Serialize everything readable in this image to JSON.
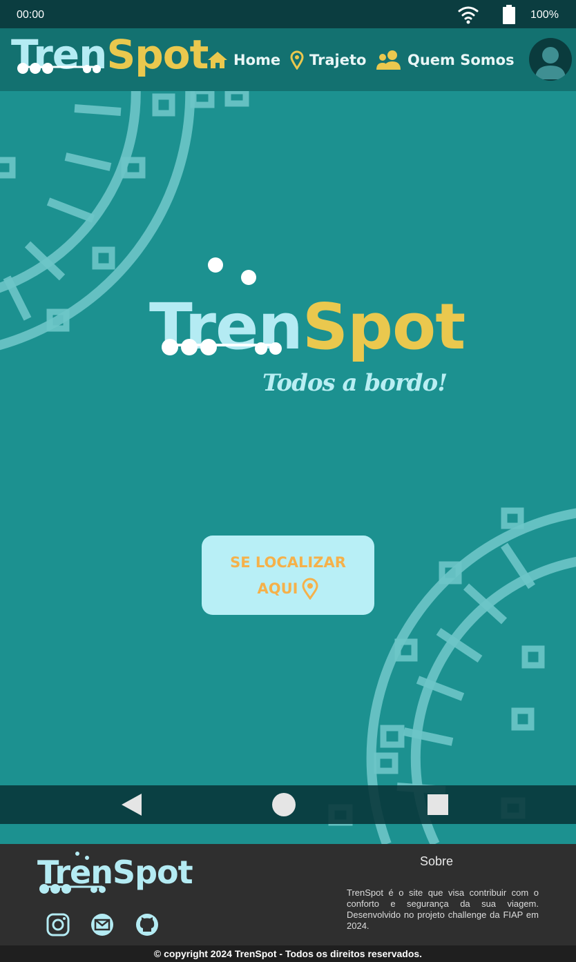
{
  "status_bar": {
    "time": "00:00",
    "battery_pct": "100%",
    "wifi_icon": "wifi-icon",
    "battery_icon": "battery-icon"
  },
  "header": {
    "logo": {
      "part1": "Tren",
      "part2": "Spot"
    },
    "nav": [
      {
        "label": "Home",
        "icon": "home-icon"
      },
      {
        "label": "Trajeto",
        "icon": "map-pin-icon"
      },
      {
        "label": "Quem Somos",
        "icon": "users-icon"
      }
    ],
    "avatar_icon": "user-avatar-icon"
  },
  "hero": {
    "logo": {
      "part1": "Tren",
      "part2": "Spot"
    },
    "tagline": "Todos a bordo!",
    "cta": {
      "line1": "SE LOCALIZAR",
      "line2": "AQUI",
      "icon": "map-pin-icon"
    }
  },
  "system_nav": {
    "back": "back-icon",
    "home": "home-circle-icon",
    "recents": "recents-icon"
  },
  "footer": {
    "logo": {
      "part1": "Tren",
      "part2": "Spot"
    },
    "social": [
      "instagram-icon",
      "mail-icon",
      "github-icon"
    ],
    "sobre_title": "Sobre",
    "sobre_text": "TrenSpot é o site que visa contribuir com o conforto e segurança da sua viagem. Desenvolvido no projeto challenge da FIAP em 2024.",
    "copyright": "© copyright 2024 TrenSpot - Todos os direitos reservados."
  },
  "colors": {
    "background": "#1c9190",
    "header": "#137170",
    "statusbar": "#0b3d40",
    "logo_light": "#b4ebf3",
    "logo_accent": "#eac84e",
    "cta_bg": "#b8eff6",
    "cta_text": "#f5b14a",
    "footer": "#2f2f2f"
  }
}
